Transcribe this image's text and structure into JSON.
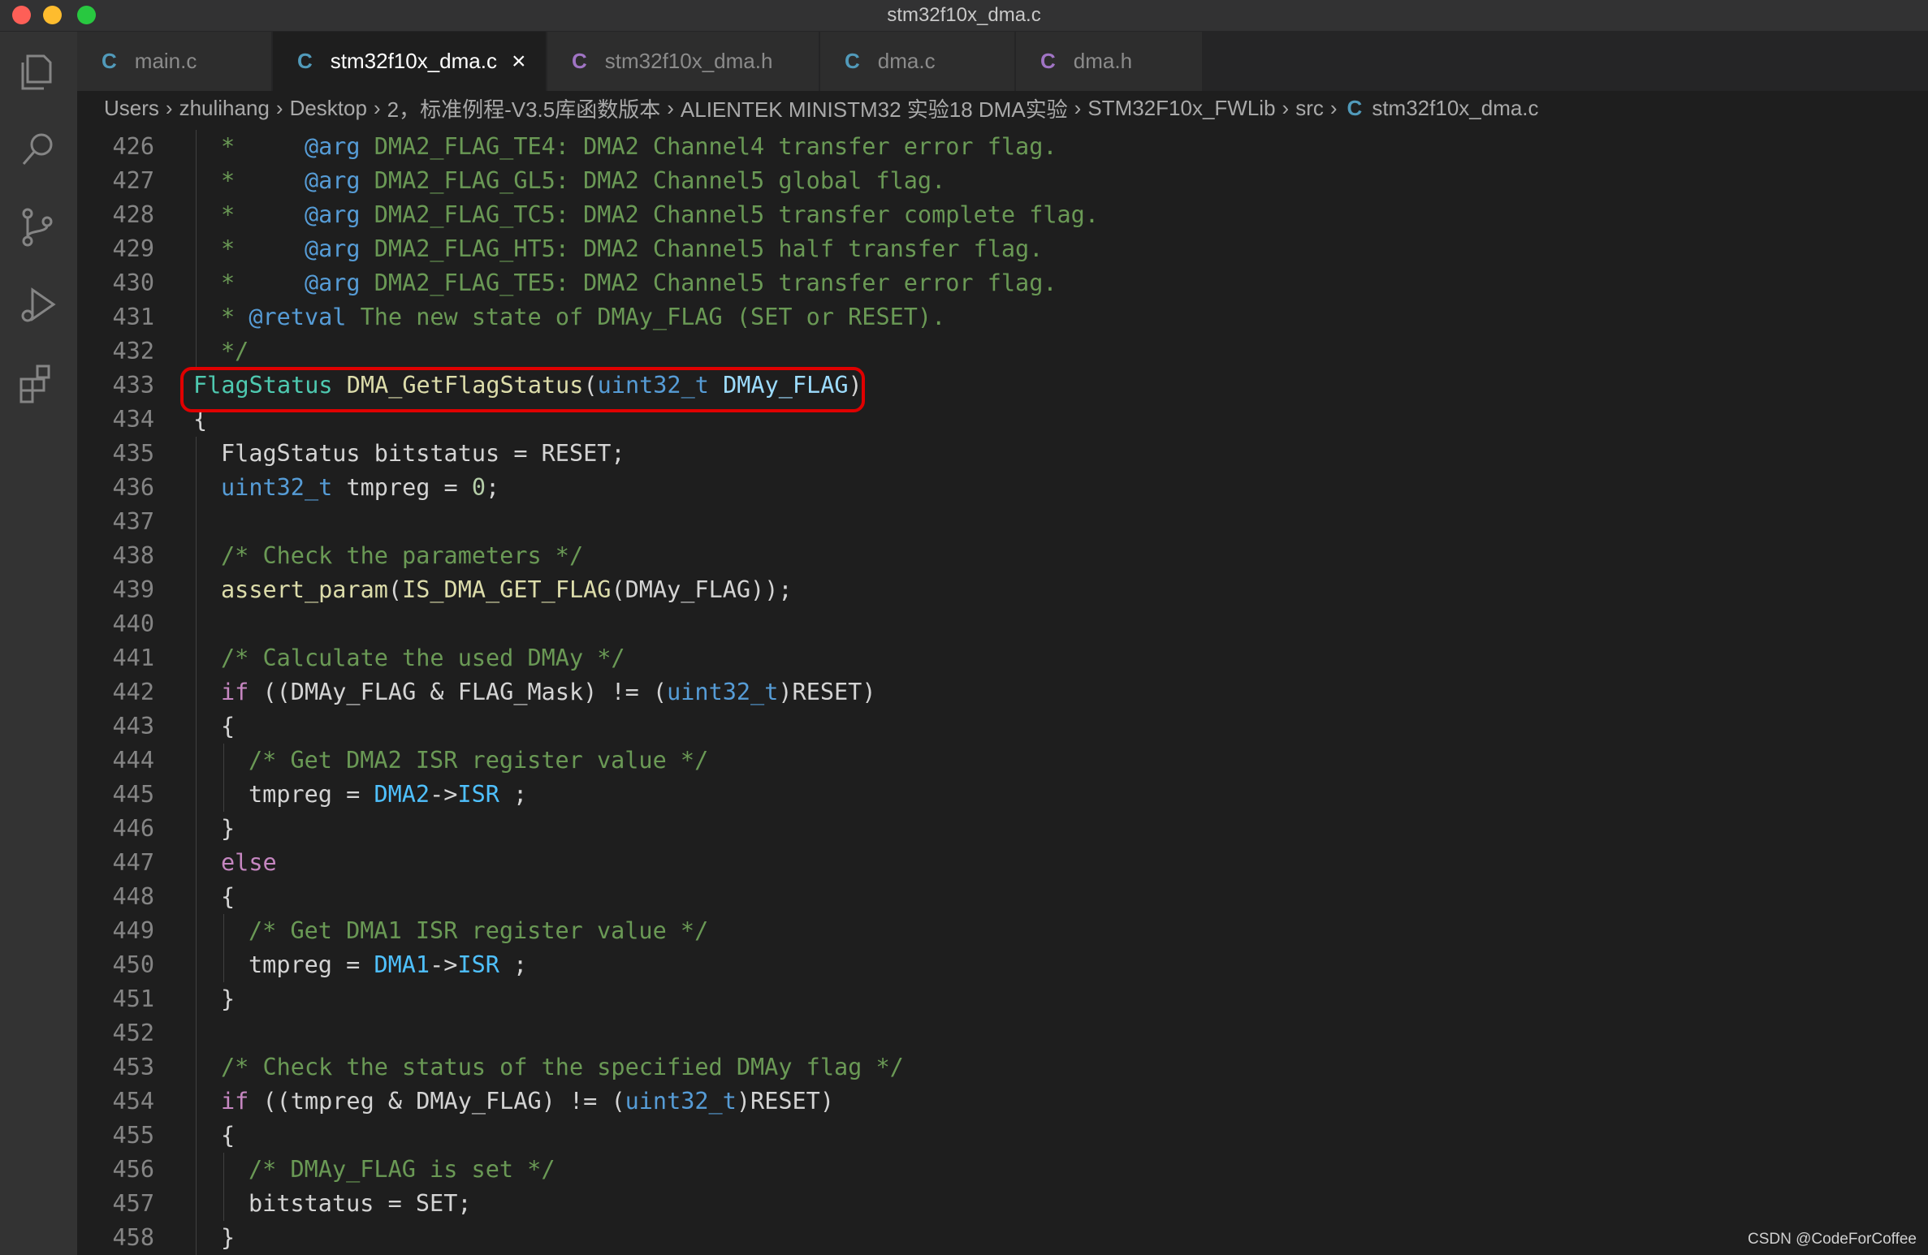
{
  "window": {
    "title": "stm32f10x_dma.c"
  },
  "tabs": [
    {
      "label": "main.c",
      "lang_icon": "C",
      "icon_color": "#519aba"
    },
    {
      "label": "stm32f10x_dma.c",
      "lang_icon": "C",
      "icon_color": "#519aba",
      "active": true,
      "close": "×"
    },
    {
      "label": "stm32f10x_dma.h",
      "lang_icon": "C",
      "icon_color": "#a074c4"
    },
    {
      "label": "dma.c",
      "lang_icon": "C",
      "icon_color": "#519aba"
    },
    {
      "label": "dma.h",
      "lang_icon": "C",
      "icon_color": "#a074c4"
    }
  ],
  "breadcrumb": {
    "items": [
      "Users",
      "zhulihang",
      "Desktop",
      "2，标准例程-V3.5库函数版本",
      "ALIENTEK MINISTM32 实验18 DMA实验",
      "STM32F10x_FWLib",
      "src"
    ],
    "file_icon": "C",
    "file": "stm32f10x_dma.c"
  },
  "editor": {
    "lines": [
      {
        "n": "426",
        "indent": 1,
        "html": "<span class=\"c-com\">*     </span><span class=\"c-tag\">@arg</span><span class=\"c-com\"> DMA2_FLAG_TE4: DMA2 Channel4 transfer error flag.</span>"
      },
      {
        "n": "427",
        "indent": 1,
        "html": "<span class=\"c-com\">*     </span><span class=\"c-tag\">@arg</span><span class=\"c-com\"> DMA2_FLAG_GL5: DMA2 Channel5 global flag.</span>"
      },
      {
        "n": "428",
        "indent": 1,
        "html": "<span class=\"c-com\">*     </span><span class=\"c-tag\">@arg</span><span class=\"c-com\"> DMA2_FLAG_TC5: DMA2 Channel5 transfer complete flag.</span>"
      },
      {
        "n": "429",
        "indent": 1,
        "html": "<span class=\"c-com\">*     </span><span class=\"c-tag\">@arg</span><span class=\"c-com\"> DMA2_FLAG_HT5: DMA2 Channel5 half transfer flag.</span>"
      },
      {
        "n": "430",
        "indent": 1,
        "html": "<span class=\"c-com\">*     </span><span class=\"c-tag\">@arg</span><span class=\"c-com\"> DMA2_FLAG_TE5: DMA2 Channel5 transfer error flag.</span>"
      },
      {
        "n": "431",
        "indent": 1,
        "html": "<span class=\"c-com\">* </span><span class=\"c-tag\">@retval</span><span class=\"c-com\"> The new state of DMAy_FLAG (SET or RESET).</span>"
      },
      {
        "n": "432",
        "indent": 1,
        "html": "<span class=\"c-com\">*/</span>"
      },
      {
        "n": "433",
        "indent": 0,
        "html": "<span class=\"c-type\">FlagStatus</span> <span class=\"c-fn\">DMA_GetFlagStatus</span>(<span class=\"c-kw\">uint32_t</span> <span class=\"c-param\">DMAy_FLAG</span>)"
      },
      {
        "n": "434",
        "indent": 0,
        "html": "{"
      },
      {
        "n": "435",
        "indent": 1,
        "html": "FlagStatus bitstatus = RESET;"
      },
      {
        "n": "436",
        "indent": 1,
        "html": "<span class=\"c-kw\">uint32_t</span> tmpreg = <span class=\"c-num\">0</span>;"
      },
      {
        "n": "437",
        "indent": 1,
        "html": ""
      },
      {
        "n": "438",
        "indent": 1,
        "html": "<span class=\"c-com\">/* Check the parameters */</span>"
      },
      {
        "n": "439",
        "indent": 1,
        "html": "<span class=\"c-fn\">assert_param</span>(<span class=\"c-fn\">IS_DMA_GET_FLAG</span>(DMAy_FLAG));"
      },
      {
        "n": "440",
        "indent": 1,
        "html": ""
      },
      {
        "n": "441",
        "indent": 1,
        "html": "<span class=\"c-com\">/* Calculate the used DMAy */</span>"
      },
      {
        "n": "442",
        "indent": 1,
        "html": "<span class=\"c-ctrl\">if</span> ((DMAy_FLAG &amp; FLAG_Mask) != (<span class=\"c-kw\">uint32_t</span>)RESET)"
      },
      {
        "n": "443",
        "indent": 1,
        "html": "{"
      },
      {
        "n": "444",
        "indent": 2,
        "html": "<span class=\"c-com\">/* Get DMA2 ISR register value */</span>"
      },
      {
        "n": "445",
        "indent": 2,
        "html": "tmpreg = <span class=\"c-blue2\">DMA2</span>-&gt;<span class=\"c-blue2\">ISR</span> ;"
      },
      {
        "n": "446",
        "indent": 1,
        "html": "}"
      },
      {
        "n": "447",
        "indent": 1,
        "html": "<span class=\"c-ctrl\">else</span>"
      },
      {
        "n": "448",
        "indent": 1,
        "html": "{"
      },
      {
        "n": "449",
        "indent": 2,
        "html": "<span class=\"c-com\">/* Get DMA1 ISR register value */</span>"
      },
      {
        "n": "450",
        "indent": 2,
        "html": "tmpreg = <span class=\"c-blue2\">DMA1</span>-&gt;<span class=\"c-blue2\">ISR</span> ;"
      },
      {
        "n": "451",
        "indent": 1,
        "html": "}"
      },
      {
        "n": "452",
        "indent": 1,
        "html": ""
      },
      {
        "n": "453",
        "indent": 1,
        "html": "<span class=\"c-com\">/* Check the status of the specified DMAy flag */</span>"
      },
      {
        "n": "454",
        "indent": 1,
        "html": "<span class=\"c-ctrl\">if</span> ((tmpreg &amp; DMAy_FLAG) != (<span class=\"c-kw\">uint32_t</span>)RESET)"
      },
      {
        "n": "455",
        "indent": 1,
        "html": "{"
      },
      {
        "n": "456",
        "indent": 2,
        "html": "<span class=\"c-com\">/* DMAy_FLAG is set */</span>"
      },
      {
        "n": "457",
        "indent": 2,
        "html": "bitstatus = SET;"
      },
      {
        "n": "458",
        "indent": 1,
        "html": "}"
      }
    ]
  },
  "watermark": "CSDN @CodeForCoffee",
  "colors": {
    "highlight_box": "#e00000",
    "editor_bg": "#1e1e1e"
  },
  "activity_icons": [
    "explorer-icon",
    "search-icon",
    "source-control-icon",
    "run-debug-icon",
    "extensions-icon"
  ]
}
